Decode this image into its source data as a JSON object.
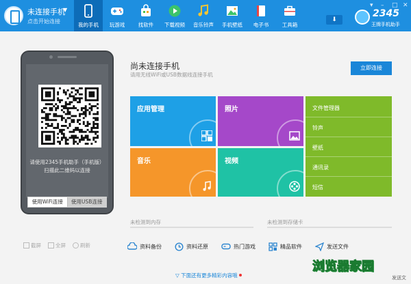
{
  "connection": {
    "title": "未连接手机",
    "subtitle": "点击开始连接"
  },
  "nav": [
    {
      "label": "我的手机",
      "icon": "phone-icon",
      "active": true
    },
    {
      "label": "玩游戏",
      "icon": "gamepad-icon"
    },
    {
      "label": "找软件",
      "icon": "bag-icon"
    },
    {
      "label": "下载视频",
      "icon": "play-icon"
    },
    {
      "label": "音乐铃声",
      "icon": "music-icon"
    },
    {
      "label": "手机壁纸",
      "icon": "picture-icon"
    },
    {
      "label": "电子书",
      "icon": "book-icon"
    },
    {
      "label": "工具箱",
      "icon": "toolbox-icon"
    }
  ],
  "logo": {
    "text": "2345",
    "sub": "王牌手机助手"
  },
  "phone": {
    "hint1": "请使用2345手机助手（手机版）",
    "hint2": "扫描此二维码以连接",
    "tab_wifi": "使用WiFi连接",
    "tab_usb": "使用USB连接"
  },
  "mini_actions": [
    "截屏",
    "全屏",
    "刷新"
  ],
  "status": {
    "title": "尚未连接手机",
    "subtitle": "请用无线WiFi或USB数据线连接手机",
    "connect_button": "立即连接"
  },
  "tiles": {
    "apps": "应用管理",
    "photos": "照片",
    "music": "音乐",
    "video": "视频"
  },
  "tile_list": [
    "文件管理器",
    "铃声",
    "壁纸",
    "通讯录",
    "短信"
  ],
  "storage": {
    "internal": "未检测到内存",
    "sdcard": "未检测到存储卡"
  },
  "toolbar": [
    "资料备份",
    "资料还原",
    "热门游戏",
    "精品软件",
    "发送文件"
  ],
  "more_link": "下面还有更多精彩内容哦",
  "watermark": "浏览器家园",
  "watermark_tail": "发送文",
  "colors": {
    "topbar": "#1e8fe0",
    "apps_tile": "#1ea0e6",
    "photos_tile": "#a548c9",
    "music_tile": "#f5962a",
    "video_tile": "#1fc2a5",
    "list_tile": "#7fba2a"
  }
}
